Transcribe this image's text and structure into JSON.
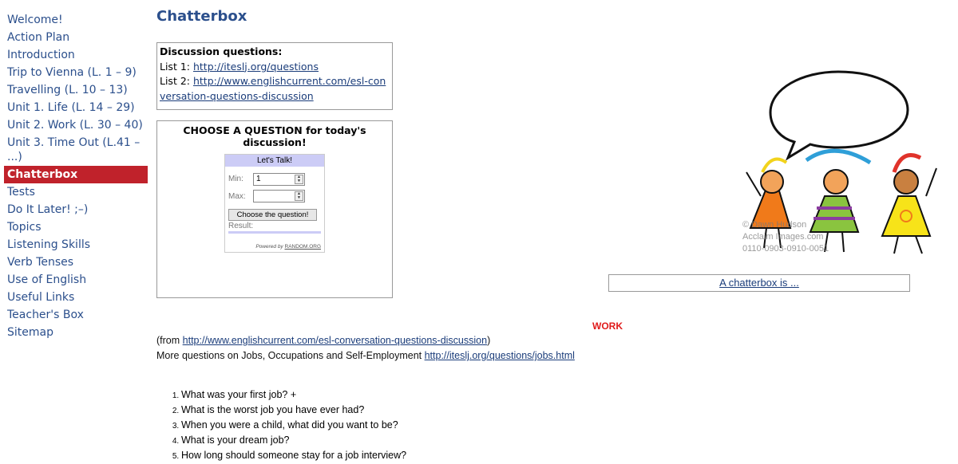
{
  "nav": [
    {
      "label": "Welcome!"
    },
    {
      "label": "Action Plan"
    },
    {
      "label": "Introduction"
    },
    {
      "label": "Trip to Vienna (L. 1 – 9)"
    },
    {
      "label": "Travelling (L. 10 – 13)"
    },
    {
      "label": "Unit 1. Life (L. 14 – 29)"
    },
    {
      "label": "Unit 2. Work (L. 30 – 40)"
    },
    {
      "label": "Unit 3. Time Out (L.41 – ...)"
    },
    {
      "label": "Chatterbox",
      "active": true
    },
    {
      "label": "Tests"
    },
    {
      "label": "Do It Later! ;–)"
    },
    {
      "label": "Topics"
    },
    {
      "label": "Listening Skills"
    },
    {
      "label": "Verb Tenses"
    },
    {
      "label": "Use of English"
    },
    {
      "label": "Useful Links"
    },
    {
      "label": "Teacher's Box"
    },
    {
      "label": "Sitemap"
    }
  ],
  "page_title": "Chatterbox",
  "discussion": {
    "heading": "Discussion questions:",
    "list1_label": "List 1: ",
    "list1_link": "http://iteslj.org/questions",
    "list2_label": "List 2: ",
    "list2_link": "http://www.englishcurrent.com/esl-conversation-questions-discussion"
  },
  "choose": {
    "heading": "CHOOSE A QUESTION for today's discussion!",
    "widget": {
      "title": "Let's Talk!",
      "min_label": "Min:",
      "min_value": "1",
      "max_label": "Max:",
      "max_value": "",
      "button": "Choose the question!",
      "result_label": "Result:",
      "powered_prefix": "Powered by ",
      "powered_link": "RANDOM.ORG"
    }
  },
  "illustration": {
    "watermark": [
      "© Dawn Hudson",
      "Acclaim Images.com",
      "0110-0903-0910-0051"
    ]
  },
  "chatterbox_link": "A chatterbox is ...",
  "work": {
    "title": "WORK",
    "from_prefix": "(from ",
    "from_link": "http://www.englishcurrent.com/esl-conversation-questions-discussion",
    "from_suffix": ")",
    "more_text": "More questions on Jobs, Occupations and Self-Employment ",
    "more_link": "http://iteslj.org/questions/jobs.html",
    "questions": [
      "What was your first job? +",
      "What is the worst job you have ever had?",
      "When you were a child, what did you want to be?",
      "What is your dream job?",
      "How long should someone stay for a job interview?"
    ]
  },
  "colors": {
    "nav_text": "#2b4f8c",
    "nav_active_bg": "#c0222b",
    "work_title": "#e01b1b",
    "widget_header": "#ccccf6"
  }
}
